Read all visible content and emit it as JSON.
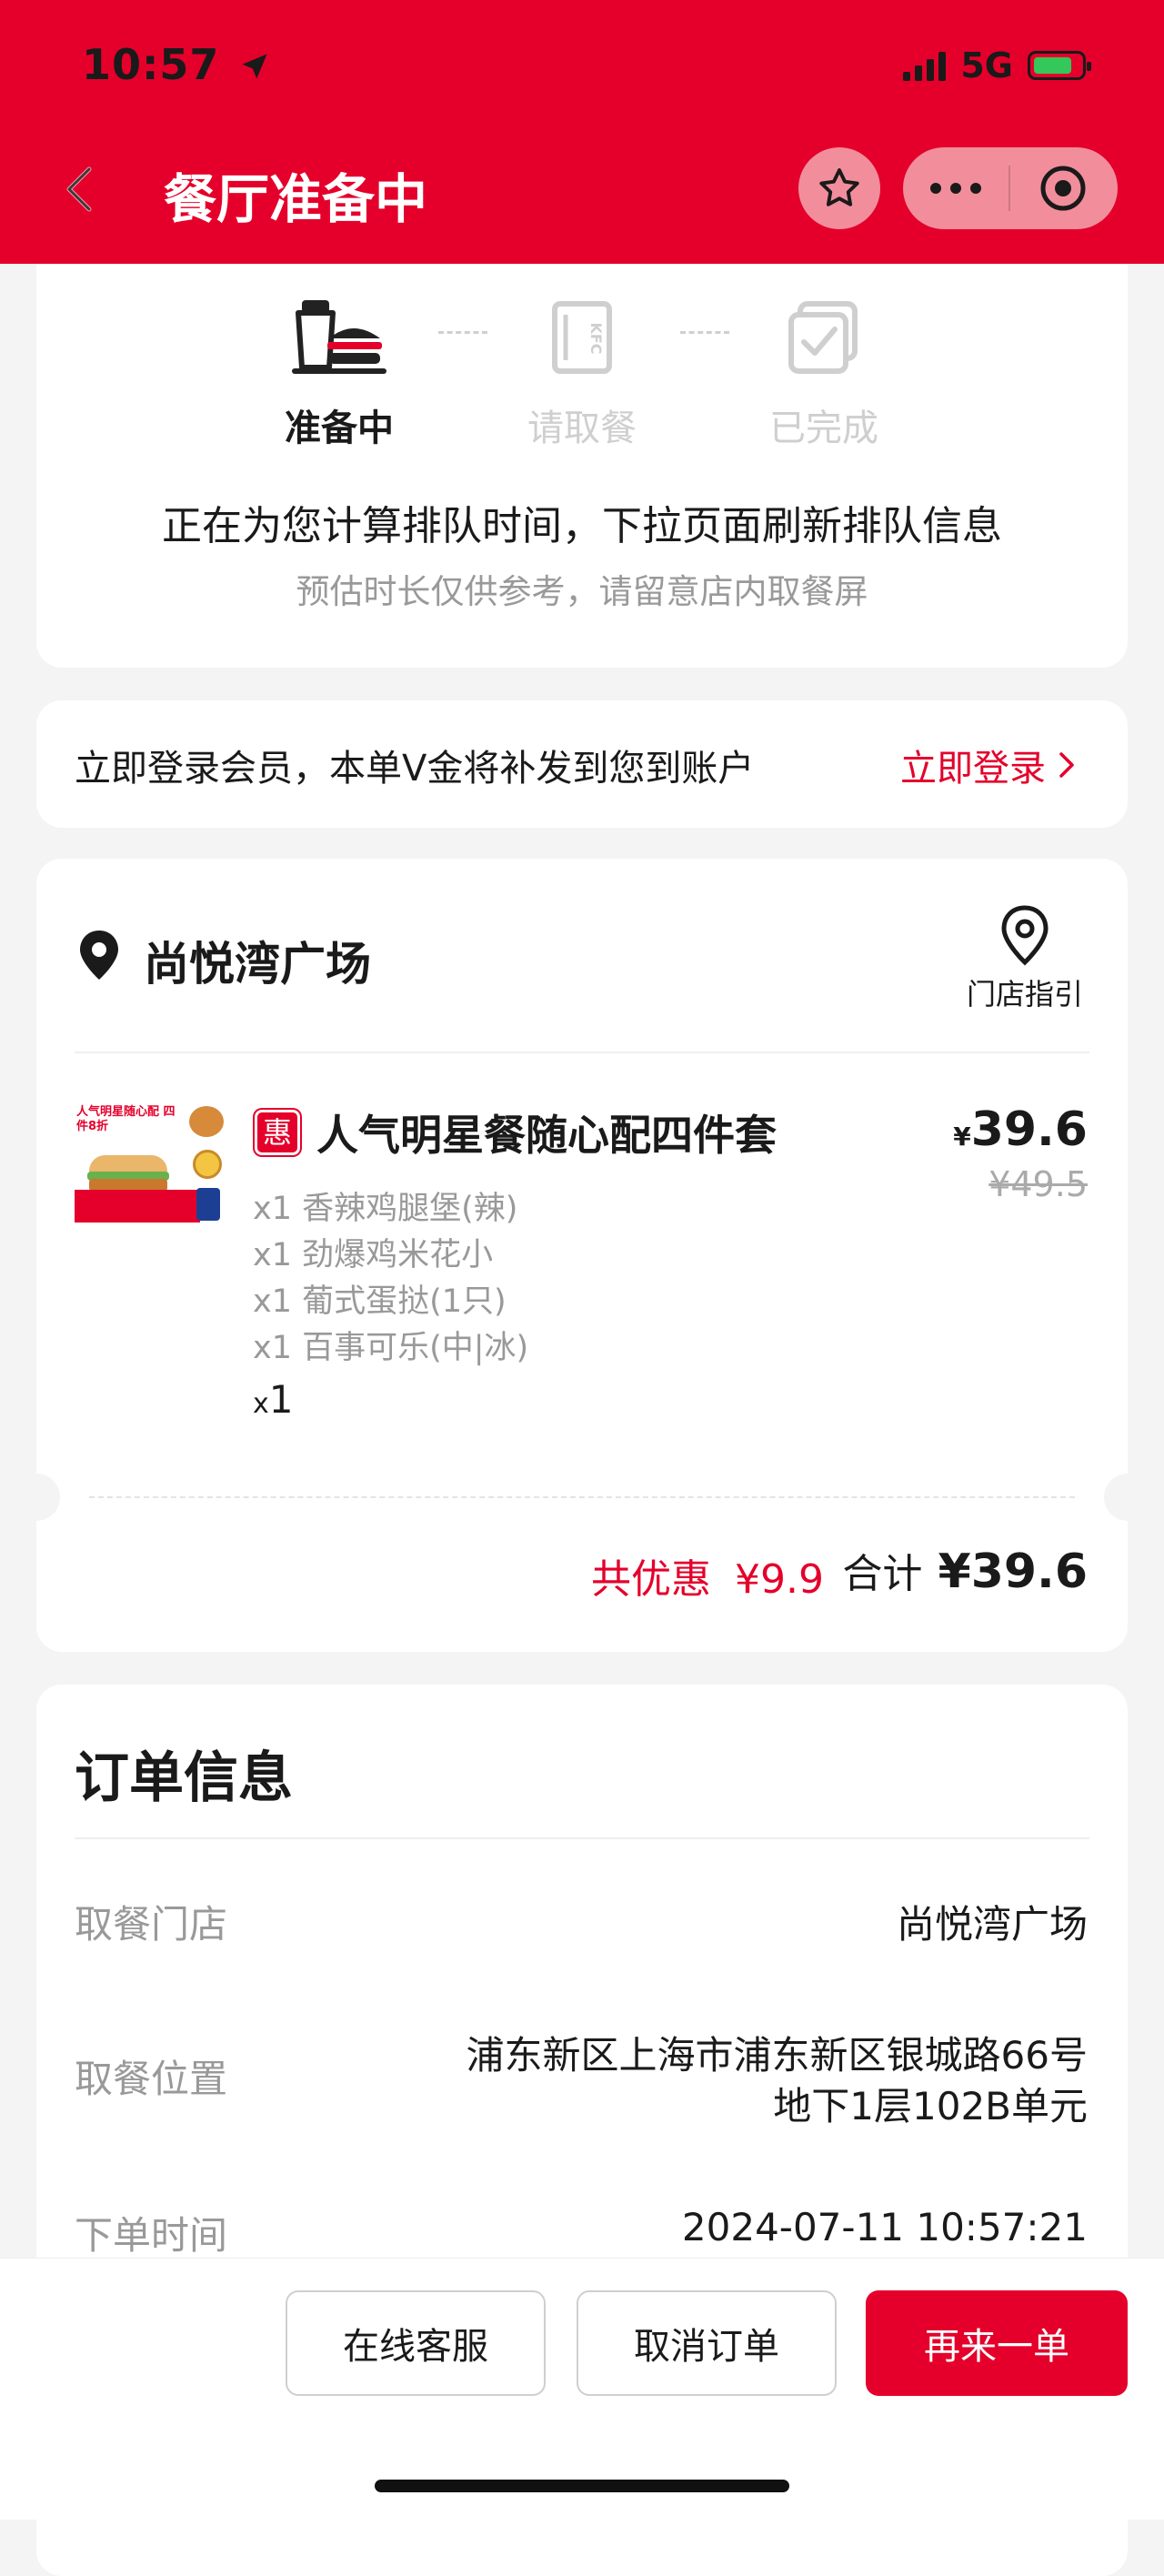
{
  "status": {
    "time": "10:57",
    "network": "5G"
  },
  "header": {
    "title": "餐厅准备中"
  },
  "progress": {
    "steps": [
      {
        "label": "准备中"
      },
      {
        "label": "请取餐"
      },
      {
        "label": "已完成"
      }
    ],
    "current_step": 0,
    "headline": "正在为您计算排队时间，下拉页面刷新排队信息",
    "subline": "预估时长仅供参考，请留意店内取餐屏"
  },
  "member": {
    "text": "立即登录会员，本单V金将补发到您到账户",
    "action": "立即登录"
  },
  "store": {
    "name": "尚悦湾广场",
    "guide": "门店指引"
  },
  "order_item": {
    "image_text": "人气明星随心配 四件8折",
    "badge": "惠",
    "name": "人气明星餐随心配四件套",
    "currency": "¥",
    "price": "39.6",
    "original_price": "¥49.5",
    "components": [
      "x1 香辣鸡腿堡(辣)",
      "x1 劲爆鸡米花小",
      "x1 葡式蛋挞(1只)",
      "x1 百事可乐(中|冰)"
    ],
    "qty_prefix": "x",
    "qty": "1"
  },
  "summary": {
    "discount_label": "共优惠",
    "discount": "¥9.9",
    "total_label": "合计",
    "total": "¥39.6"
  },
  "order_info": {
    "title": "订单信息",
    "rows": [
      {
        "label": "取餐门店",
        "value": "尚悦湾广场"
      },
      {
        "label": "取餐位置",
        "value_line1": "浦东新区上海市浦东新区银城路66号",
        "value_line2": "地下1层102B单元"
      },
      {
        "label": "下单时间",
        "value": "2024-07-11 10:57:21"
      }
    ]
  },
  "actions": {
    "service": "在线客服",
    "cancel": "取消订单",
    "reorder": "再来一单"
  },
  "colors": {
    "brand_red": "#e4002b",
    "muted": "#999999"
  }
}
